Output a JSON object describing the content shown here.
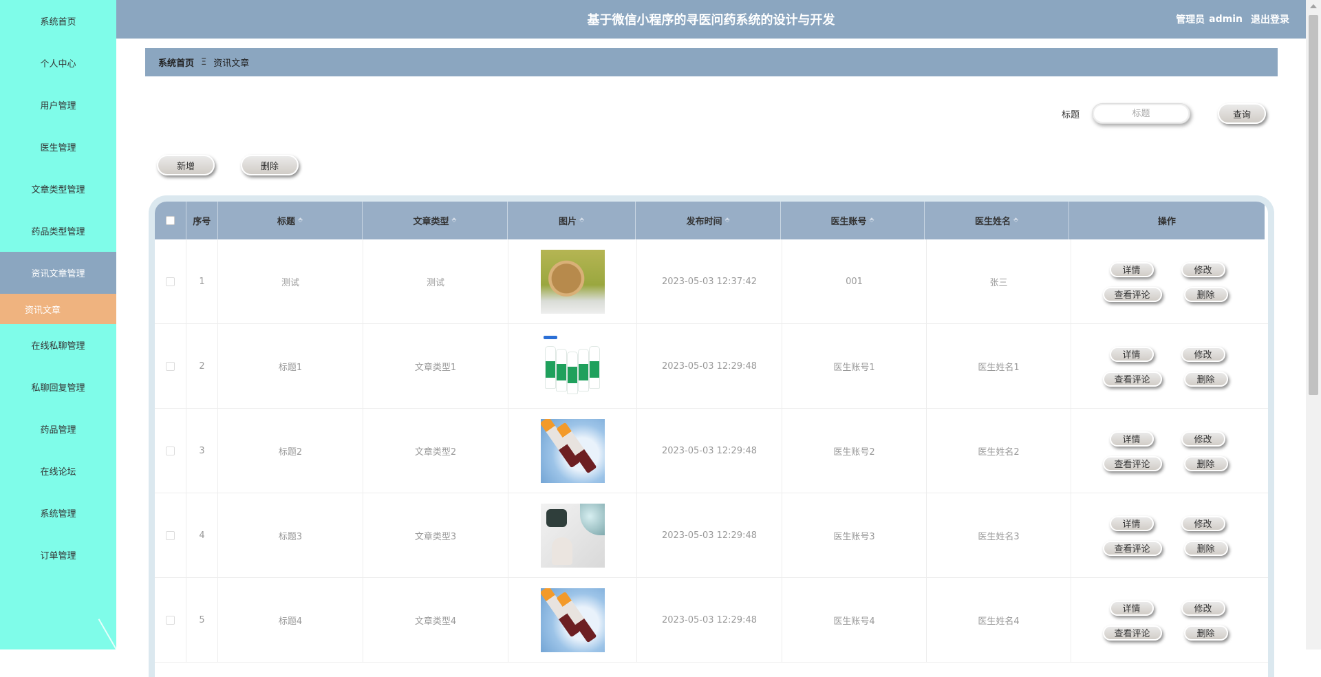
{
  "sidebar": {
    "items": [
      {
        "label": "系统首页"
      },
      {
        "label": "个人中心"
      },
      {
        "label": "用户管理"
      },
      {
        "label": "医生管理"
      },
      {
        "label": "文章类型管理"
      },
      {
        "label": "药品类型管理"
      },
      {
        "label": "资讯文章管理"
      },
      {
        "label": "在线私聊管理"
      },
      {
        "label": "私聊回复管理"
      },
      {
        "label": "药品管理"
      },
      {
        "label": "在线论坛"
      },
      {
        "label": "系统管理"
      },
      {
        "label": "订单管理"
      }
    ],
    "active_index": 6,
    "submenu": {
      "label": "资讯文章"
    },
    "colors": {
      "bg": "#7ffce9",
      "active": "#8ba6c0",
      "sub": "#efb37f"
    }
  },
  "header": {
    "title": "基于微信小程序的寻医问药系统的设计与开发",
    "role": "管理员",
    "username": "admin",
    "logout": "退出登录",
    "color": "#8ba6c0"
  },
  "breadcrumb": {
    "home": "系统首页",
    "separator": "Ξ",
    "current": "资讯文章"
  },
  "search": {
    "label": "标题",
    "placeholder": "标题",
    "button": "查询"
  },
  "actions": {
    "add": "新增",
    "delete": "删除"
  },
  "table": {
    "columns": [
      "",
      "序号",
      "标题",
      "文章类型",
      "图片",
      "发布时间",
      "医生账号",
      "医生姓名",
      "操作"
    ],
    "sortable": [
      false,
      false,
      true,
      true,
      true,
      true,
      true,
      true,
      false
    ],
    "sort_icon": "⬘",
    "row_actions": {
      "detail": "详情",
      "edit": "修改",
      "comments": "查看评论",
      "delete": "删除"
    },
    "rows": [
      {
        "index": "1",
        "title": "测试",
        "type": "测试",
        "image": "rabbit-photo",
        "time": "2023-05-03 12:37:42",
        "account": "001",
        "name": "张三"
      },
      {
        "index": "2",
        "title": "标题1",
        "type": "文章类型1",
        "image": "bottles-photo",
        "time": "2023-05-03 12:29:48",
        "account": "医生账号1",
        "name": "医生姓名1"
      },
      {
        "index": "3",
        "title": "标题2",
        "type": "文章类型2",
        "image": "test-tubes-photo",
        "time": "2023-05-03 12:29:48",
        "account": "医生账号2",
        "name": "医生姓名2"
      },
      {
        "index": "4",
        "title": "标题3",
        "type": "文章类型3",
        "image": "medical-device-photo",
        "time": "2023-05-03 12:29:48",
        "account": "医生账号3",
        "name": "医生姓名3"
      },
      {
        "index": "5",
        "title": "标题4",
        "type": "文章类型4",
        "image": "test-tubes-photo",
        "time": "2023-05-03 12:29:48",
        "account": "医生账号4",
        "name": "医生姓名4"
      }
    ]
  }
}
